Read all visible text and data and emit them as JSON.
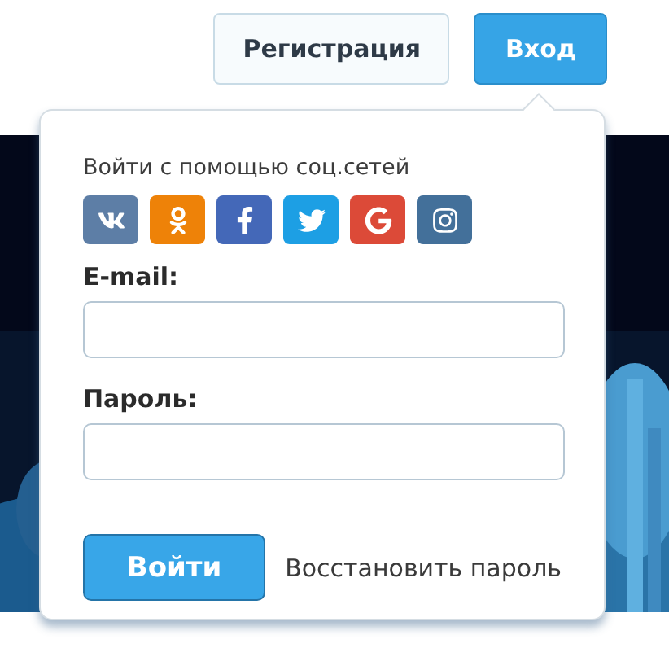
{
  "header": {
    "buttons": [
      {
        "label": "Регистрация",
        "kind": "outline"
      },
      {
        "label": "Вход",
        "kind": "primary"
      }
    ]
  },
  "login_popup": {
    "social_title": "Войти с помощью соц.сетей",
    "social": [
      {
        "kind": "vk",
        "color": "#5d7ea6"
      },
      {
        "kind": "ok",
        "color": "#ee8208"
      },
      {
        "kind": "facebook",
        "color": "#4468b8"
      },
      {
        "kind": "twitter",
        "color": "#1d9fe4"
      },
      {
        "kind": "google",
        "color": "#dc4a38"
      },
      {
        "kind": "instagram",
        "color": "#43709a"
      }
    ],
    "fields": [
      {
        "label": "E-mail:"
      },
      {
        "label": "Пароль:"
      }
    ],
    "submit": "Войти",
    "recover_link": "Восстановить пароль"
  }
}
